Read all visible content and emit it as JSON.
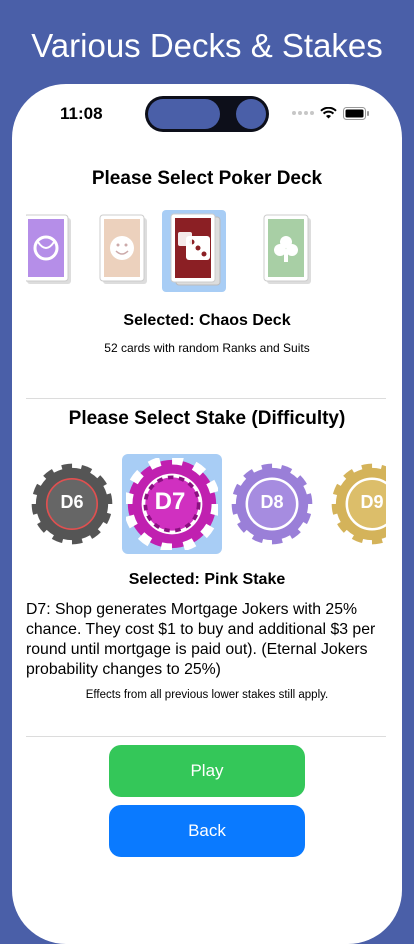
{
  "promo": {
    "title": "Various Decks & Stakes"
  },
  "status_bar": {
    "time": "11:08"
  },
  "deck_section": {
    "title": "Please Select Poker Deck",
    "decks": [
      {
        "id": "purple-deck",
        "color": "#b58ee8",
        "selected": false
      },
      {
        "id": "smiley-deck",
        "color": "#e8c8b0",
        "selected": false
      },
      {
        "id": "chaos-deck",
        "color": "#8b1f24",
        "selected": true
      },
      {
        "id": "green-deck",
        "color": "#9cc39a",
        "selected": false
      }
    ],
    "selected_label": "Selected: Chaos Deck",
    "description": "52 cards with random Ranks and Suits"
  },
  "stake_section": {
    "title": "Please Select Stake (Difficulty)",
    "stakes": [
      {
        "label": "D6",
        "color": "#555555",
        "selected": false
      },
      {
        "label": "D7",
        "color": "#c020b0",
        "selected": true
      },
      {
        "label": "D8",
        "color": "#9a7fd8",
        "selected": false
      },
      {
        "label": "D9",
        "color": "#d4b35a",
        "selected": false
      }
    ],
    "selected_label": "Selected: Pink Stake",
    "description": "D7: Shop generates Mortgage Jokers with 25% chance. They cost $1 to buy and additional $3 per round until mortgage is paid out). (Eternal Jokers probability changes to 25%)",
    "note": "Effects from all previous lower stakes still apply."
  },
  "buttons": {
    "play": "Play",
    "back": "Back"
  }
}
